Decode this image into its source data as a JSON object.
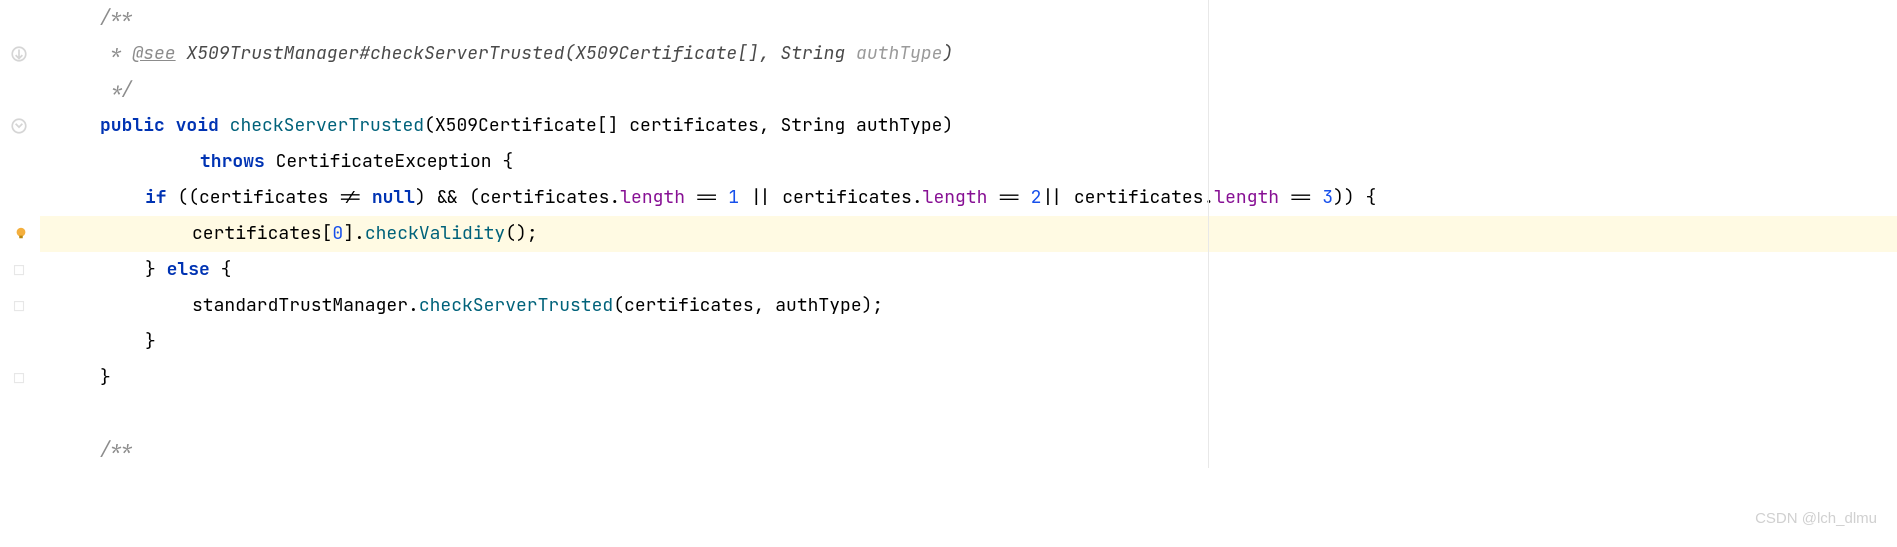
{
  "code": {
    "l1": "/**",
    "l2_star": " * ",
    "l2_tag": "@see",
    "l2_ref": " X509TrustManager#checkServerTrusted",
    "l2_paren_open": "(",
    "l2_type1": "X509Certificate[], String ",
    "l2_param": "authType",
    "l2_paren_close": ")",
    "l3": " */",
    "l4_public": "public",
    "l4_sp1": " ",
    "l4_void": "void",
    "l4_sp2": " ",
    "l4_method": "checkServerTrusted",
    "l4_sig": "(X509Certificate[] certificates, String authType)",
    "l5_throws": "throws",
    "l5_rest": " CertificateException {",
    "l6_if": "if",
    "l6_a": " ((certificates != ",
    "l6_null": "null",
    "l6_b": ") && (certificates.",
    "l6_len1": "length",
    "l6_c": " == ",
    "l6_n1": "1",
    "l6_d": " || certificates.",
    "l6_len2": "length",
    "l6_e": " == ",
    "l6_n2": "2",
    "l6_f": "|| certificates.",
    "l6_len3": "length",
    "l6_g": " == ",
    "l6_n3": "3",
    "l6_h": ")) {",
    "l7_a": "certificates[",
    "l7_n0": "0",
    "l7_b": "].",
    "l7_method": "checkValidity",
    "l7_c": "();",
    "l8_a": "} ",
    "l8_else": "else",
    "l8_b": " {",
    "l9_a": "standardTrustManager.",
    "l9_method": "checkServerTrusted",
    "l9_b": "(certificates, authType);",
    "l10": "}",
    "l11": "}",
    "l12": "",
    "l13": "/**"
  },
  "icons": {
    "override": "override-icon",
    "bulb": "intention-bulb-icon"
  },
  "watermark": "CSDN @lch_dlmu"
}
